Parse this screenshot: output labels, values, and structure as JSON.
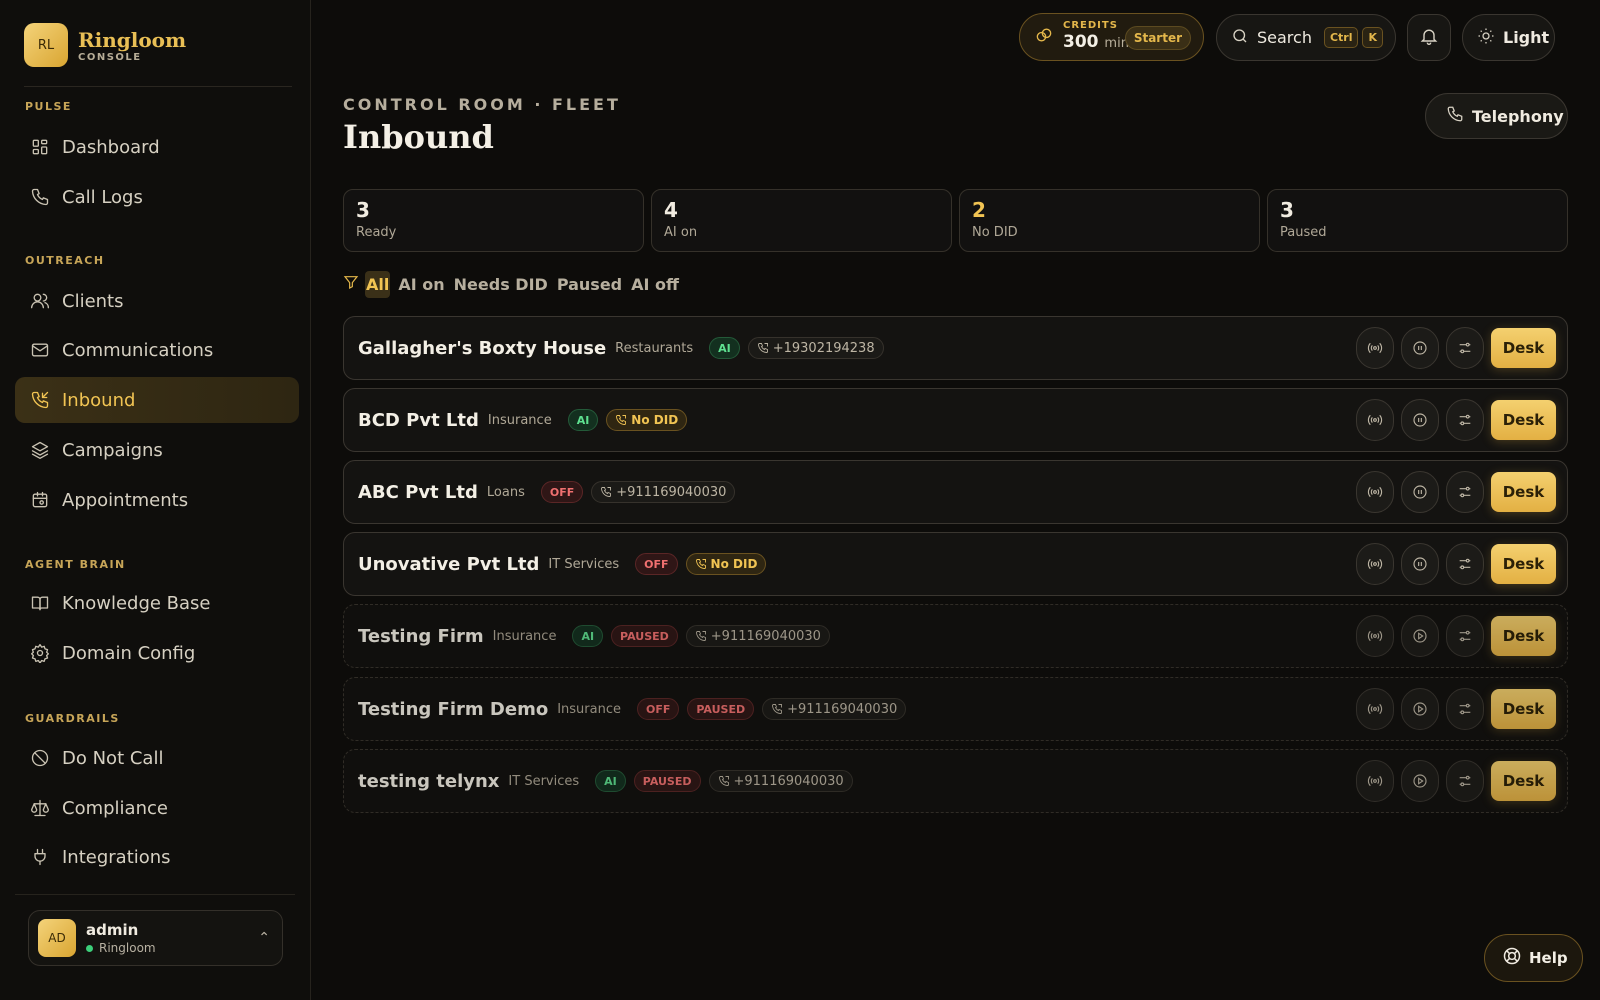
{
  "brand": {
    "logo": "RL",
    "name": "Ringloom",
    "subtitle": "CONSOLE"
  },
  "sidebar": {
    "sections": [
      {
        "title": "PULSE",
        "items": [
          {
            "label": "Dashboard",
            "icon": "dashboard-icon"
          },
          {
            "label": "Call Logs",
            "icon": "phone-icon"
          }
        ]
      },
      {
        "title": "OUTREACH",
        "items": [
          {
            "label": "Clients",
            "icon": "users-icon"
          },
          {
            "label": "Communications",
            "icon": "mail-icon"
          },
          {
            "label": "Inbound",
            "icon": "phone-incoming-icon",
            "active": true
          },
          {
            "label": "Campaigns",
            "icon": "layers-icon"
          },
          {
            "label": "Appointments",
            "icon": "calendar-icon"
          }
        ]
      },
      {
        "title": "AGENT BRAIN",
        "items": [
          {
            "label": "Knowledge Base",
            "icon": "book-icon"
          },
          {
            "label": "Domain Config",
            "icon": "gear-icon"
          }
        ]
      },
      {
        "title": "GUARDRAILS",
        "items": [
          {
            "label": "Do Not Call",
            "icon": "ban-icon"
          },
          {
            "label": "Compliance",
            "icon": "scale-icon"
          },
          {
            "label": "Integrations",
            "icon": "plug-icon"
          }
        ]
      }
    ]
  },
  "user": {
    "avatar": "AD",
    "name": "admin",
    "org": "Ringloom"
  },
  "topbar": {
    "credits_label": "CREDITS",
    "credits_value": "300",
    "credits_unit": "min",
    "plan": "Starter",
    "search_label": "Search",
    "kbd": [
      "Ctrl",
      "K"
    ],
    "theme_label": "Light"
  },
  "header": {
    "eyebrow": "CONTROL ROOM · FLEET",
    "title": "Inbound",
    "telephony_label": "Telephony"
  },
  "stats": [
    {
      "value": "3",
      "label": "Ready",
      "highlight": false
    },
    {
      "value": "4",
      "label": "AI on",
      "highlight": false
    },
    {
      "value": "2",
      "label": "No DID",
      "highlight": true
    },
    {
      "value": "3",
      "label": "Paused",
      "highlight": false
    }
  ],
  "filters": [
    "All",
    "AI on",
    "Needs DID",
    "Paused",
    "AI off"
  ],
  "active_filter": "All",
  "rows": [
    {
      "name": "Gallagher's Boxty House",
      "category": "Restaurants",
      "ai": "AI",
      "paused": false,
      "phone": "+19302194238"
    },
    {
      "name": "BCD Pvt Ltd",
      "category": "Insurance",
      "ai": "AI",
      "paused": false,
      "phone": "No DID"
    },
    {
      "name": "ABC Pvt Ltd",
      "category": "Loans",
      "ai": "OFF",
      "paused": false,
      "phone": "+911169040030"
    },
    {
      "name": "Unovative Pvt Ltd",
      "category": "IT Services",
      "ai": "OFF",
      "paused": false,
      "phone": "No DID"
    },
    {
      "name": "Testing Firm",
      "category": "Insurance",
      "ai": "AI",
      "paused": true,
      "phone": "+911169040030"
    },
    {
      "name": "Testing Firm Demo",
      "category": "Insurance",
      "ai": "OFF",
      "paused": true,
      "phone": "+911169040030"
    },
    {
      "name": "testing telynx",
      "category": "IT Services",
      "ai": "AI",
      "paused": true,
      "phone": "+911169040030"
    }
  ],
  "row_labels": {
    "paused": "PAUSED",
    "desk": "Desk"
  },
  "help_label": "Help"
}
